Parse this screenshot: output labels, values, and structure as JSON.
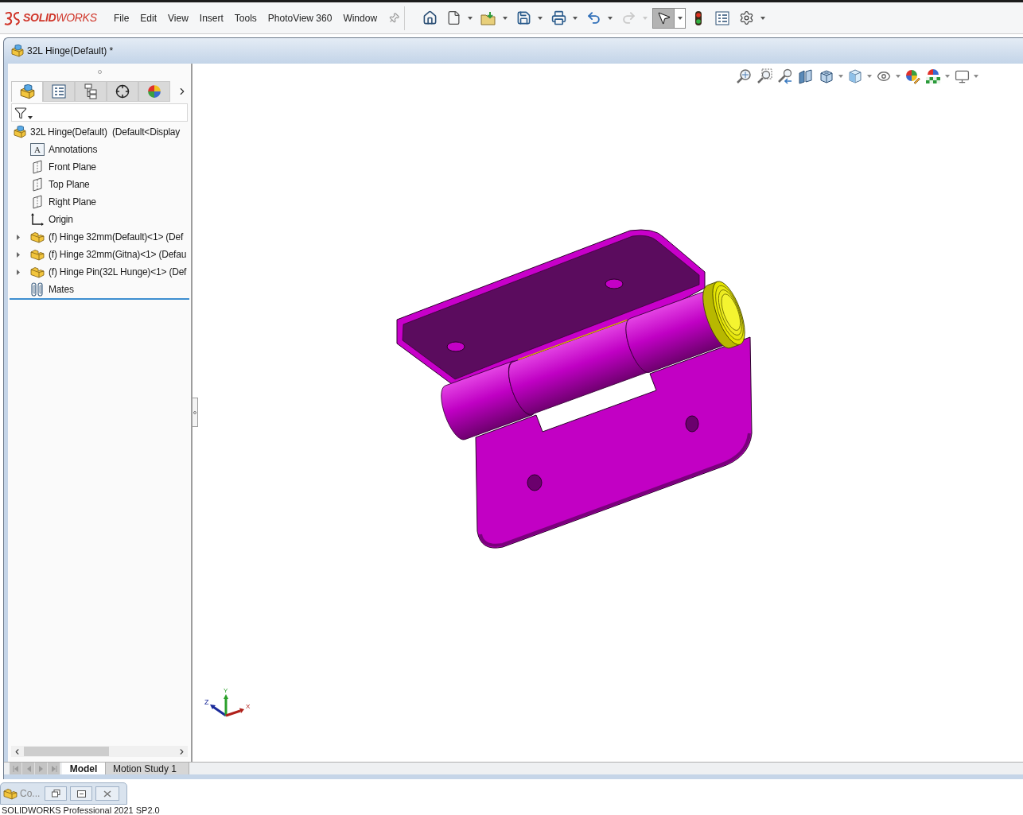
{
  "app": {
    "logo": "**SOLID**WORKS"
  },
  "menu": [
    "File",
    "Edit",
    "View",
    "Insert",
    "Tools",
    "PhotoView 360",
    "Window"
  ],
  "toolbar": [
    {
      "kind": "home",
      "dropdown": false,
      "pressed": false,
      "disabled": false
    },
    {
      "kind": "new",
      "dropdown": true,
      "pressed": false,
      "disabled": false
    },
    {
      "kind": "open",
      "dropdown": true,
      "pressed": false,
      "disabled": false
    },
    {
      "kind": "save",
      "dropdown": true,
      "pressed": false,
      "disabled": false
    },
    {
      "kind": "print",
      "dropdown": true,
      "pressed": false,
      "disabled": false
    },
    {
      "kind": "undo",
      "dropdown": true,
      "pressed": false,
      "disabled": false
    },
    {
      "kind": "redo",
      "dropdown": true,
      "pressed": false,
      "disabled": true
    },
    {
      "kind": "select",
      "dropdown": true,
      "pressed": true,
      "disabled": false
    },
    {
      "kind": "rebuild",
      "dropdown": false,
      "pressed": false,
      "disabled": false
    },
    {
      "kind": "properties",
      "dropdown": false,
      "pressed": false,
      "disabled": false
    },
    {
      "kind": "options",
      "dropdown": true,
      "pressed": false,
      "disabled": false
    }
  ],
  "document": {
    "title": "32L Hinge(Default) *"
  },
  "feature_manager": {
    "tabs": [
      {
        "kind": "feature-tree",
        "selected": true
      },
      {
        "kind": "property-manager",
        "selected": false
      },
      {
        "kind": "configuration-manager",
        "selected": false
      },
      {
        "kind": "dimxpert",
        "selected": false
      },
      {
        "kind": "display-manager",
        "selected": false
      }
    ],
    "tree": [
      {
        "label": "32L Hinge(Default)  (Default<Display",
        "kind": "assembly",
        "children": [
          {
            "label": "Annotations",
            "kind": "annotations",
            "icon_text": "A"
          },
          {
            "label": "Front Plane",
            "kind": "plane"
          },
          {
            "label": "Top Plane",
            "kind": "plane"
          },
          {
            "label": "Right Plane",
            "kind": "plane"
          },
          {
            "label": "Origin",
            "kind": "origin"
          },
          {
            "label": "(f) Hinge 32mm(Default)<1> (Def",
            "kind": "part",
            "expanded": false
          },
          {
            "label": "(f) Hinge 32mm(Gitna)<1> (Defau",
            "kind": "part",
            "expanded": false
          },
          {
            "label": "(f) Hinge Pin(32L Hunge)<1> (Def",
            "kind": "part",
            "expanded": false
          },
          {
            "label": "Mates",
            "kind": "mates"
          }
        ]
      }
    ]
  },
  "heads_up_toolbar": [
    {
      "kind": "zoom-fit",
      "dropdown": false
    },
    {
      "kind": "zoom-area",
      "dropdown": false
    },
    {
      "kind": "previous-view",
      "dropdown": false
    },
    {
      "kind": "section-view",
      "dropdown": false
    },
    {
      "kind": "view-orientation",
      "dropdown": true
    },
    {
      "kind": "display-style",
      "dropdown": true
    },
    {
      "kind": "hide-show",
      "dropdown": true
    },
    {
      "kind": "edit-appearance",
      "dropdown": false
    },
    {
      "kind": "apply-scene",
      "dropdown": true
    },
    {
      "kind": "view-settings",
      "dropdown": true
    }
  ],
  "triad": {
    "x": "X",
    "y": "Y",
    "z": "Z"
  },
  "bottom_bar": {
    "nav": [
      {
        "kind": "first",
        "disabled": true
      },
      {
        "kind": "previous",
        "disabled": true
      },
      {
        "kind": "next",
        "disabled": true
      },
      {
        "kind": "last",
        "disabled": true
      }
    ],
    "tabs": [
      {
        "label": "Model",
        "selected": true
      },
      {
        "label": "Motion Study 1",
        "selected": false
      }
    ]
  },
  "minimized_window": {
    "title": "Co..."
  },
  "status_bar": {
    "text": "SOLIDWORKS Professional 2021 SP2.0"
  }
}
